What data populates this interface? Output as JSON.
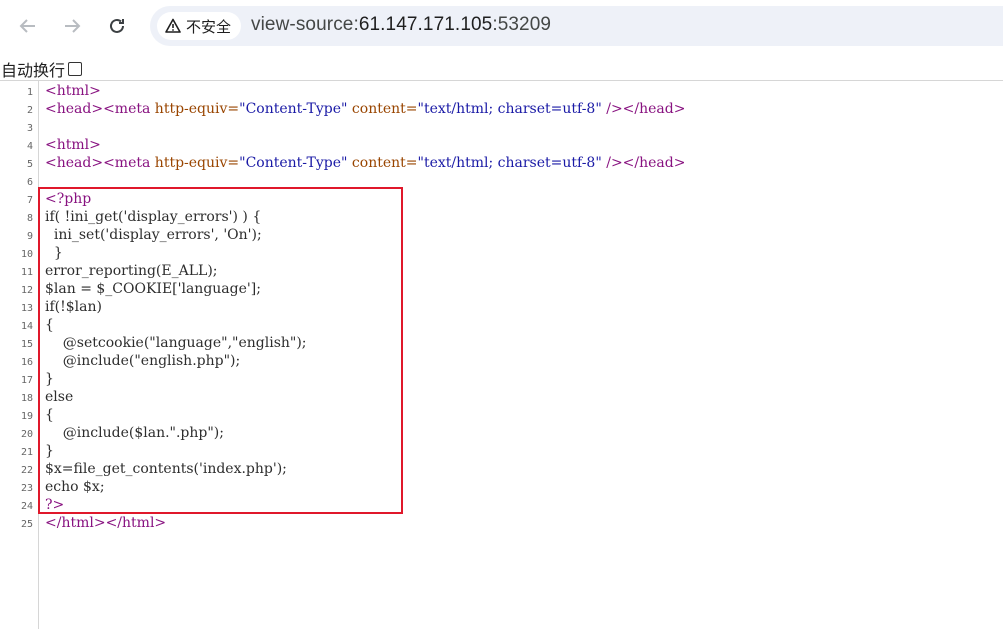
{
  "toolbar": {
    "back_icon": "back-arrow-icon",
    "forward_icon": "forward-arrow-icon",
    "reload_icon": "reload-icon",
    "security_label": "不安全",
    "url_scheme": "view-source:",
    "url_host": "61.147.171.105",
    "url_port": ":53209"
  },
  "wrap": {
    "label": "自动换行"
  },
  "source": {
    "line_numbers": [
      "1",
      "2",
      "3",
      "4",
      "5",
      "6",
      "7",
      "8",
      "9",
      "10",
      "11",
      "12",
      "13",
      "14",
      "15",
      "16",
      "17",
      "18",
      "19",
      "20",
      "21",
      "22",
      "23",
      "24",
      "25"
    ],
    "l1": "<html>",
    "l2_tag_open": "<head><meta ",
    "l2_attr1": "http-equiv=",
    "l2_val1": "\"Content-Type\"",
    "l2_attr2": " content=",
    "l2_val2": "\"text/html; charset=utf-8\"",
    "l2_tag_close": " /></head>",
    "l4": "<html>",
    "l5_tag_open": "<head><meta ",
    "l5_attr1": "http-equiv=",
    "l5_val1": "\"Content-Type\"",
    "l5_attr2": " content=",
    "l5_val2": "\"text/html; charset=utf-8\"",
    "l5_tag_close": " /></head>",
    "l7": "<?php",
    "l8": "if( !ini_get('display_errors') ) {",
    "l9": "  ini_set('display_errors', 'On');",
    "l10": "  }",
    "l11": "error_reporting(E_ALL);",
    "l12": "$lan = $_COOKIE['language'];",
    "l13": "if(!$lan)",
    "l14": "{",
    "l15": "    @setcookie(\"language\",\"english\");",
    "l16": "    @include(\"english.php\");",
    "l17": "}",
    "l18": "else",
    "l19": "{",
    "l20": "    @include($lan.\".php\");",
    "l21": "}",
    "l22": "$x=file_get_contents('index.php');",
    "l23": "echo $x;",
    "l24": "?>",
    "l25": "</html></html>"
  },
  "colors": {
    "tag": "#881280",
    "attr": "#994500",
    "value": "#1a1aa6",
    "highlight_box": "#e0182b"
  }
}
